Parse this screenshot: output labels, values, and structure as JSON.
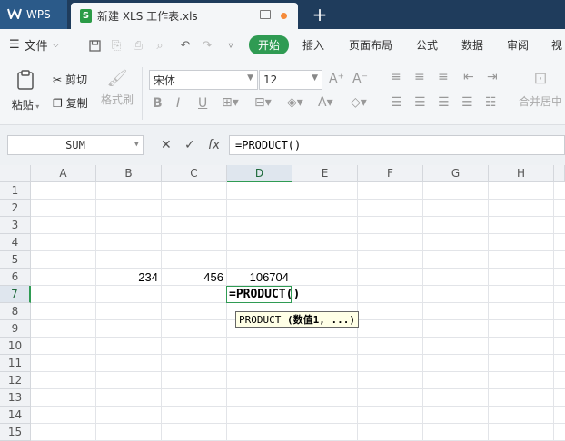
{
  "titlebar": {
    "app_name": "WPS",
    "file_name": "新建 XLS 工作表.xls",
    "file_badge": "S",
    "new_tab": "+"
  },
  "menubar": {
    "file_label": "文件",
    "tabs": [
      "开始",
      "插入",
      "页面布局",
      "公式",
      "数据",
      "审阅",
      "视"
    ]
  },
  "ribbon": {
    "paste_label": "粘贴",
    "cut_label": "剪切",
    "copy_label": "复制",
    "format_painter_label": "格式刷",
    "font_name": "宋体",
    "font_size": "12",
    "merge_label": "合并居中"
  },
  "formulabar": {
    "name_box": "SUM",
    "formula": "=PRODUCT()"
  },
  "grid": {
    "columns": [
      "A",
      "B",
      "C",
      "D",
      "E",
      "F",
      "G",
      "H"
    ],
    "rows": [
      "1",
      "2",
      "3",
      "4",
      "5",
      "6",
      "7",
      "8",
      "9",
      "10",
      "11",
      "12",
      "13",
      "14",
      "15"
    ],
    "active_column": "D",
    "active_row": "7",
    "cells": {
      "B6": "234",
      "C6": "456",
      "D6": "106704"
    },
    "editing_cell_text": "=PRODUCT()",
    "tooltip_func": "PRODUCT",
    "tooltip_args": "(数值1, ...)"
  },
  "colors": {
    "accent": "#2f9b53",
    "titlebar": "#1f3c5c"
  }
}
